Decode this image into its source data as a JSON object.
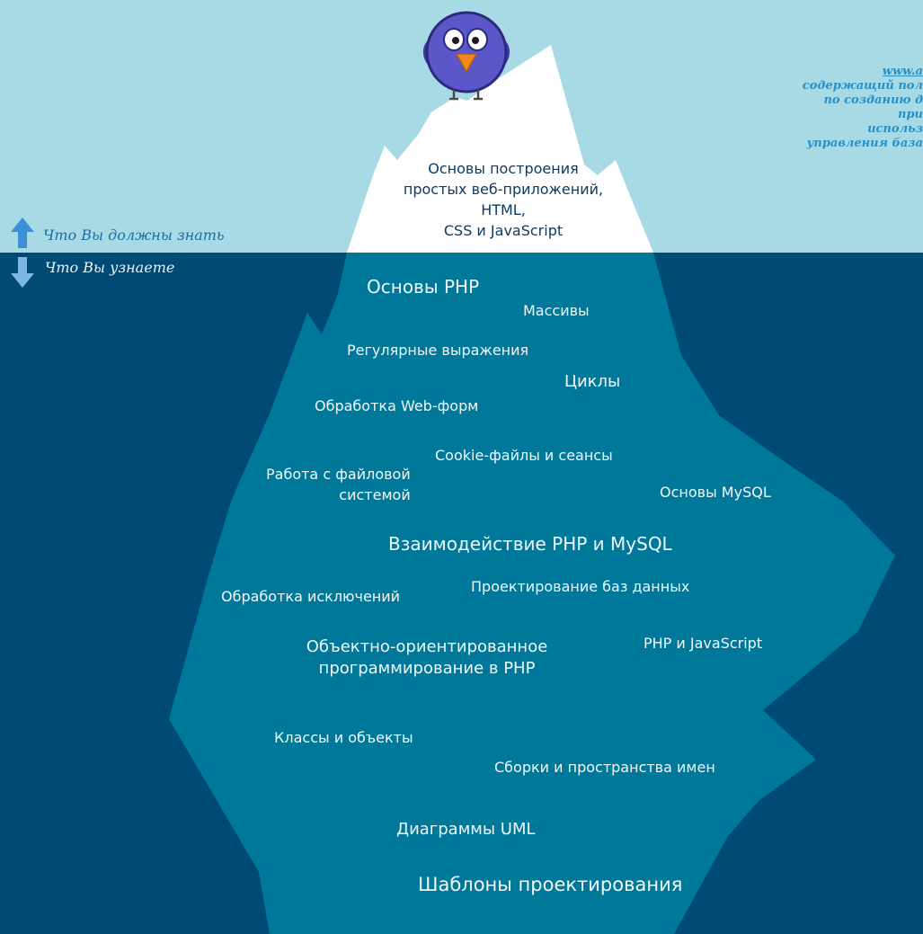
{
  "colors": {
    "sky": "#a8dae6",
    "water": "#004a76",
    "iceberg_top": "#ffffff",
    "iceberg_bottom": "#00789a",
    "mascot": "#5b57c9",
    "beak": "#f08a1e"
  },
  "icons": {
    "up": "arrow-up-icon",
    "down": "arrow-down-icon",
    "mascot": "blue-bird-mascot"
  },
  "legend": {
    "above": "Что Вы должны знать",
    "below": "Что Вы узнаете"
  },
  "corner_text": {
    "line1": "www.a",
    "line2": "содержащий пол",
    "line3": "по созданию д",
    "line4": "при",
    "line5": "использ",
    "line6": "управления база"
  },
  "tip": {
    "line1": "Основы построения",
    "line2": "простых веб-приложений,",
    "line3": "HTML,",
    "line4": "CSS и JavaScript"
  },
  "topics": {
    "php_basics": "Основы PHP",
    "arrays": "Массивы",
    "regex": "Регулярные выражения",
    "loops": "Циклы",
    "forms": "Обработка Web-форм",
    "cookies": "Cookie-файлы и сеансы",
    "filesystem_1": "Работа с файловой",
    "filesystem_2": "системой",
    "mysql_basics": "Основы MySQL",
    "php_mysql": "Взаимодействие PHP и MySQL",
    "exceptions": "Обработка исключений",
    "db_design": "Проектирование баз данных",
    "oop_1": "Объектно-ориентированное",
    "oop_2": "программирование в PHP",
    "php_js": "PHP и JavaScript",
    "classes": "Классы и объекты",
    "namespaces": "Сборки и пространства имен",
    "uml": "Диаграммы UML",
    "patterns": "Шаблоны проектирования"
  }
}
